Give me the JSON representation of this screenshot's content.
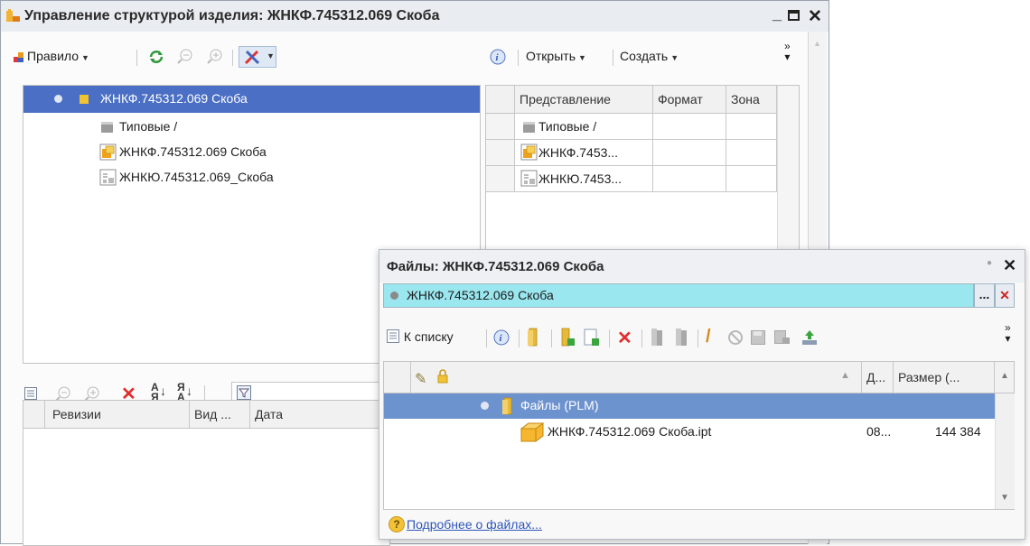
{
  "main_window": {
    "title": "Управление структурой изделия: ЖНКФ.745312.069 Скоба",
    "toolbar": {
      "rule_label": "Правило",
      "open_label": "Открыть",
      "create_label": "Создать"
    },
    "tree": {
      "root_label": "ЖНКФ.745312.069 Скоба",
      "children": [
        "Типовые /",
        "ЖНКФ.745312.069 Скоба",
        "ЖНКЮ.745312.069_Скоба"
      ]
    },
    "right_table": {
      "columns": [
        "Представление",
        "Формат",
        "Зона"
      ],
      "rows": [
        "Типовые /",
        "ЖНКФ.7453...",
        "ЖНКЮ.7453..."
      ]
    },
    "revisions_table": {
      "columns": [
        "Ревизии",
        "Вид ...",
        "Дата"
      ]
    }
  },
  "files_window": {
    "title": "Файлы: ЖНКФ.745312.069 Скоба",
    "object_field": "ЖНКФ.745312.069 Скоба",
    "select_button": "...",
    "toolbar": {
      "to_list_label": "К списку"
    },
    "table": {
      "columns": [
        "Д...",
        "Размер (..."
      ],
      "group_label": "Файлы (PLM)",
      "file": {
        "name": "ЖНКФ.745312.069 Скоба.ipt",
        "date": "08...",
        "size": "144 384"
      }
    },
    "more_link": "Подробнее о файлах..."
  },
  "colors": {
    "selection": "#4a6fc4",
    "group_row": "#6d93cf",
    "object_field_bg": "#9be7ef",
    "title_bar_bg": "#e9ecf0"
  }
}
